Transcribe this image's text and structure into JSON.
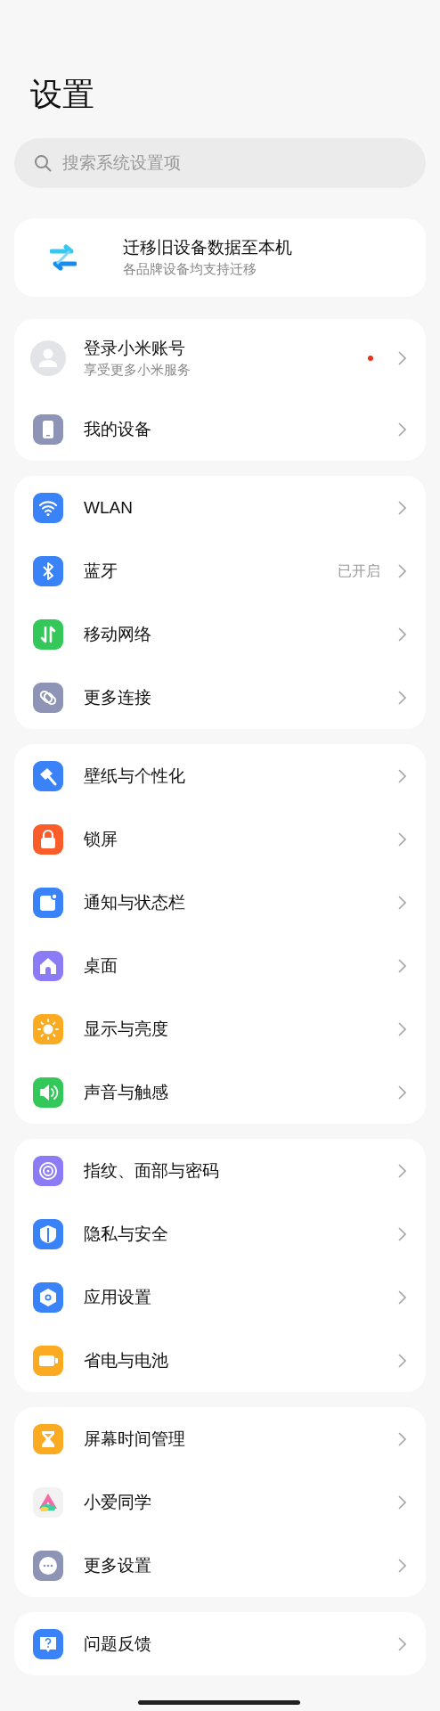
{
  "title": "设置",
  "search": {
    "placeholder": "搜索系统设置项"
  },
  "migration": {
    "title": "迁移旧设备数据至本机",
    "subtitle": "各品牌设备均支持迁移"
  },
  "groups": [
    {
      "items": [
        {
          "kind": "account",
          "label": "登录小米账号",
          "subtitle": "享受更多小米服务",
          "unread": true
        },
        {
          "kind": "device",
          "label": "我的设备",
          "unread": false
        }
      ]
    },
    {
      "items": [
        {
          "kind": "wlan",
          "label": "WLAN",
          "unread": false
        },
        {
          "kind": "bluetooth",
          "label": "蓝牙",
          "value": "已开启",
          "unread": false
        },
        {
          "kind": "mobile",
          "label": "移动网络",
          "unread": false
        },
        {
          "kind": "link",
          "label": "更多连接",
          "unread": false
        }
      ]
    },
    {
      "items": [
        {
          "kind": "brush",
          "label": "壁纸与个性化",
          "unread": false
        },
        {
          "kind": "lock",
          "label": "锁屏",
          "unread": false
        },
        {
          "kind": "notify",
          "label": "通知与状态栏",
          "unread": false
        },
        {
          "kind": "home",
          "label": "桌面",
          "unread": false
        },
        {
          "kind": "display",
          "label": "显示与亮度",
          "unread": false
        },
        {
          "kind": "sound",
          "label": "声音与触感",
          "unread": false
        }
      ]
    },
    {
      "items": [
        {
          "kind": "fingerprint",
          "label": "指纹、面部与密码",
          "unread": false
        },
        {
          "kind": "privacy",
          "label": "隐私与安全",
          "unread": false
        },
        {
          "kind": "apps",
          "label": "应用设置",
          "unread": false
        },
        {
          "kind": "battery",
          "label": "省电与电池",
          "unread": false
        }
      ]
    },
    {
      "items": [
        {
          "kind": "hourglass",
          "label": "屏幕时间管理",
          "unread": false
        },
        {
          "kind": "assistant",
          "label": "小爱同学",
          "unread": false
        },
        {
          "kind": "more",
          "label": "更多设置",
          "unread": false
        }
      ]
    },
    {
      "items": [
        {
          "kind": "feedback",
          "label": "问题反馈",
          "unread": false
        }
      ]
    }
  ]
}
